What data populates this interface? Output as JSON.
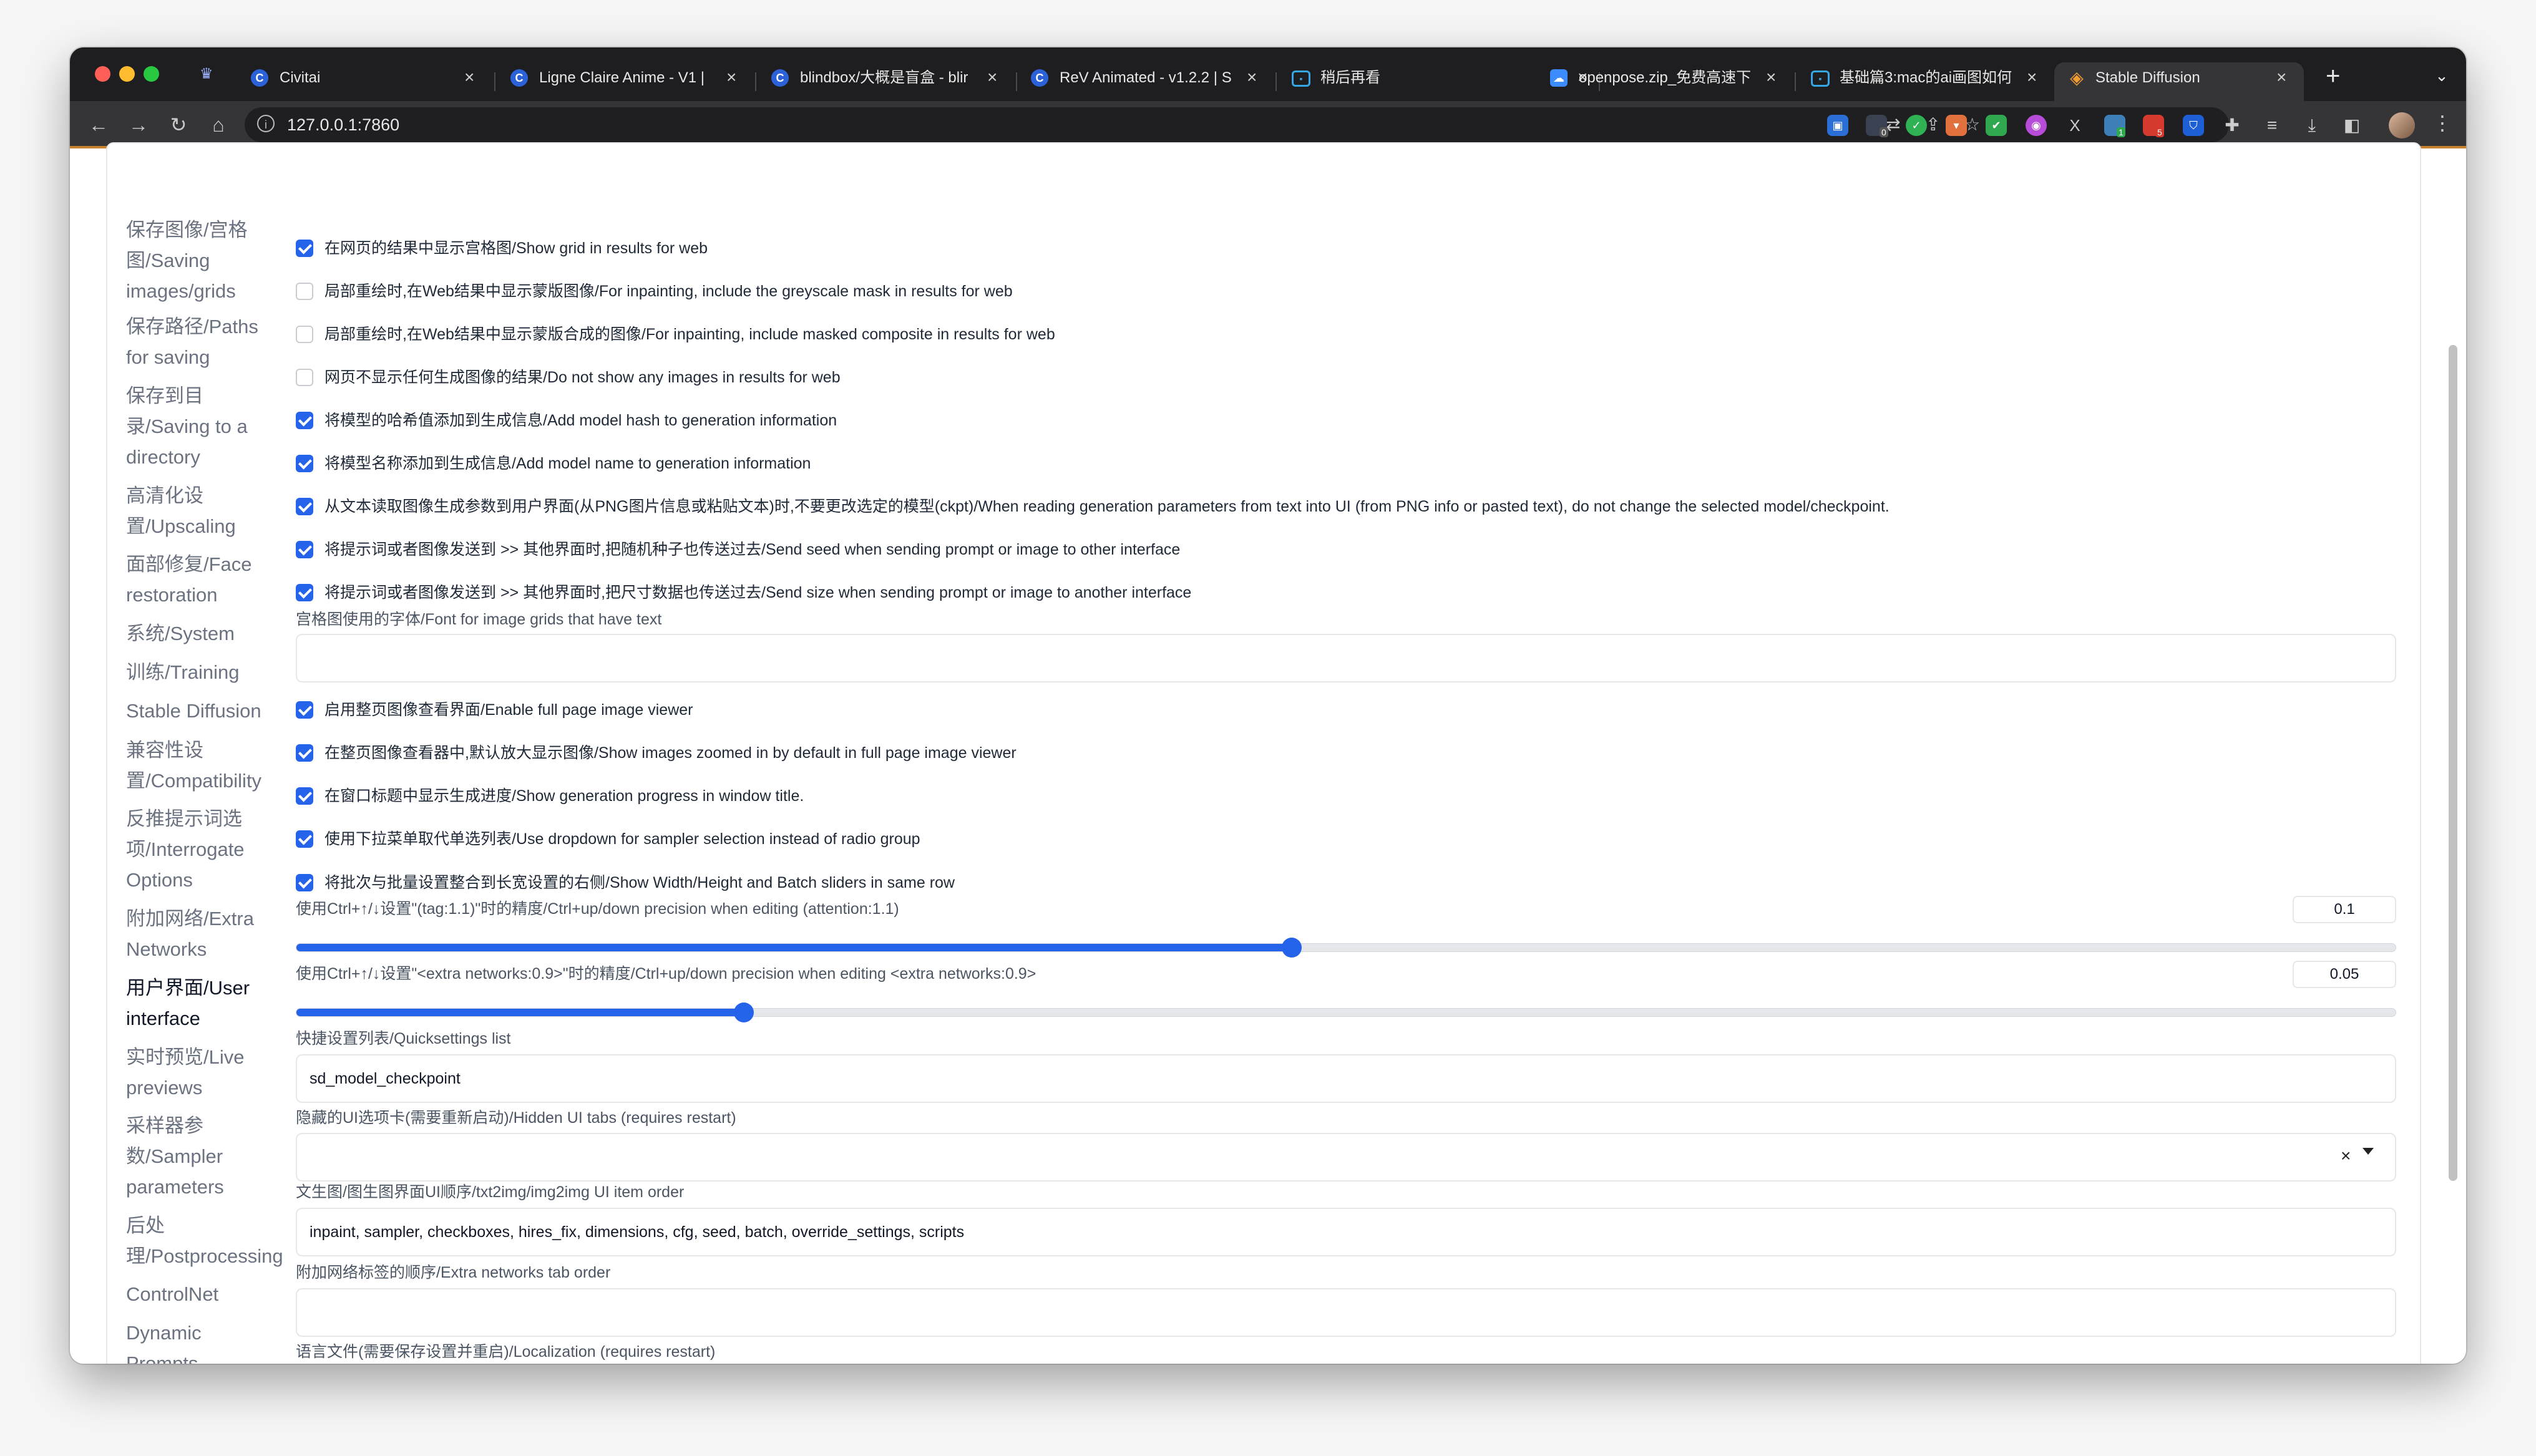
{
  "browser": {
    "tabs": [
      {
        "title": "Civitai",
        "favicon": "civitai-icon"
      },
      {
        "title": "Ligne Claire Anime - V1 |",
        "favicon": "civitai-icon"
      },
      {
        "title": "blindbox/大概是盲盒 - blir",
        "favicon": "civitai-icon"
      },
      {
        "title": "ReV Animated - v1.2.2 | S",
        "favicon": "civitai-icon"
      },
      {
        "title": "稍后再看",
        "favicon": "bilibili-icon"
      },
      {
        "title": "openpose.zip_免费高速下",
        "favicon": "cloud-drive-icon"
      },
      {
        "title": "基础篇3:mac的ai画图如何",
        "favicon": "bilibili-icon"
      },
      {
        "title": "Stable Diffusion",
        "favicon": "stable-diffusion-icon"
      }
    ],
    "url": "127.0.0.1:7860",
    "extension_badges": {
      "badge_a": "0",
      "badge_b": "1",
      "badge_c": "5"
    }
  },
  "sidebar": {
    "items": [
      {
        "label": "保存图像/宫格图/Saving images/grids",
        "lines": [
          "保存图像/宫格",
          "图/Saving",
          "images/grids"
        ]
      },
      {
        "label": "保存路径/Paths for saving",
        "lines": [
          "保存路径/Paths",
          "for saving"
        ]
      },
      {
        "label": "保存到目录/Saving to a directory",
        "lines": [
          "保存到目",
          "录/Saving to a",
          "directory"
        ]
      },
      {
        "label": "高清化设置/Upscaling",
        "lines": [
          "高清化设",
          "置/Upscaling"
        ]
      },
      {
        "label": "面部修复/Face restoration",
        "lines": [
          "面部修复/Face",
          "restoration"
        ]
      },
      {
        "label": "系统/System",
        "lines": [
          "系统/System"
        ]
      },
      {
        "label": "训练/Training",
        "lines": [
          "训练/Training"
        ]
      },
      {
        "label": "Stable Diffusion",
        "lines": [
          "Stable Diffusion"
        ]
      },
      {
        "label": "兼容性设置/Compatibility",
        "lines": [
          "兼容性设",
          "置/Compatibility"
        ]
      },
      {
        "label": "反推提示词选项/Interrogate Options",
        "lines": [
          "反推提示词选",
          "项/Interrogate",
          "Options"
        ]
      },
      {
        "label": "附加网络/Extra Networks",
        "lines": [
          "附加网络/Extra",
          "Networks"
        ]
      },
      {
        "label": "用户界面/User interface",
        "lines": [
          "用户界面/User",
          "interface"
        ],
        "active": true
      },
      {
        "label": "实时预览/Live previews",
        "lines": [
          "实时预览/Live",
          "previews"
        ]
      },
      {
        "label": "采样器参数/Sampler parameters",
        "lines": [
          "采样器参",
          "数/Sampler",
          "parameters"
        ]
      },
      {
        "label": "后处理/Postprocessing",
        "lines": [
          "后处",
          "理/Postprocessing"
        ]
      },
      {
        "label": "ControlNet",
        "lines": [
          "ControlNet"
        ]
      },
      {
        "label": "Dynamic Prompts",
        "lines": [
          "Dynamic",
          "Prompts"
        ]
      }
    ]
  },
  "settings": {
    "checkboxes_group1": [
      {
        "checked": true,
        "label": "在网页的结果中显示宫格图/Show grid in results for web"
      },
      {
        "checked": false,
        "label": "局部重绘时,在Web结果中显示蒙版图像/For inpainting, include the greyscale mask in results for web"
      },
      {
        "checked": false,
        "label": "局部重绘时,在Web结果中显示蒙版合成的图像/For inpainting, include masked composite in results for web"
      },
      {
        "checked": false,
        "label": "网页不显示任何生成图像的结果/Do not show any images in results for web"
      },
      {
        "checked": true,
        "label": "将模型的哈希值添加到生成信息/Add model hash to generation information"
      },
      {
        "checked": true,
        "label": "将模型名称添加到生成信息/Add model name to generation information"
      },
      {
        "checked": true,
        "label": "从文本读取图像生成参数到用户界面(从PNG图片信息或粘贴文本)时,不要更改选定的模型(ckpt)/When reading generation parameters from text into UI (from PNG info or pasted text), do not change the selected model/checkpoint."
      },
      {
        "checked": true,
        "label": "将提示词或者图像发送到 >> 其他界面时,把随机种子也传送过去/Send seed when sending prompt or image to other interface"
      },
      {
        "checked": true,
        "label": "将提示词或者图像发送到 >> 其他界面时,把尺寸数据也传送过去/Send size when sending prompt or image to another interface"
      }
    ],
    "font_field": {
      "label": "宫格图使用的字体/Font for image grids that have text",
      "value": ""
    },
    "checkboxes_group2": [
      {
        "checked": true,
        "label": "启用整页图像查看界面/Enable full page image viewer"
      },
      {
        "checked": true,
        "label": "在整页图像查看器中,默认放大显示图像/Show images zoomed in by default in full page image viewer"
      },
      {
        "checked": true,
        "label": "在窗口标题中显示生成进度/Show generation progress in window title."
      },
      {
        "checked": true,
        "label": "使用下拉菜单取代单选列表/Use dropdown for sampler selection instead of radio group"
      },
      {
        "checked": true,
        "label": "将批次与批量设置整合到长宽设置的右侧/Show Width/Height and Batch sliders in same row"
      }
    ],
    "slider_attention": {
      "label": "使用Ctrl+↑/↓设置\"(tag:1.1)\"时的精度/Ctrl+up/down precision when editing (attention:1.1)",
      "value": "0.1",
      "fraction": 0.474
    },
    "slider_extra": {
      "label": "使用Ctrl+↑/↓设置\"<extra networks:0.9>\"时的精度/Ctrl+up/down precision when editing <extra networks:0.9>",
      "value": "0.05",
      "fraction": 0.213
    },
    "quicksettings": {
      "label": "快捷设置列表/Quicksettings list",
      "value": "sd_model_checkpoint"
    },
    "hidden_tabs": {
      "label": "隐藏的UI选项卡(需要重新启动)/Hidden UI tabs (requires restart)",
      "value": ""
    },
    "ui_order": {
      "label": "文生图/图生图界面UI顺序/txt2img/img2img UI item order",
      "value": "inpaint, sampler, checkboxes, hires_fix, dimensions, cfg, seed, batch, override_settings, scripts"
    },
    "extra_tab_order": {
      "label": "附加网络标签的顺序/Extra networks tab order",
      "value": ""
    },
    "localization": {
      "label": "语言文件(需要保存设置并重启)/Localization (requires restart)"
    }
  }
}
